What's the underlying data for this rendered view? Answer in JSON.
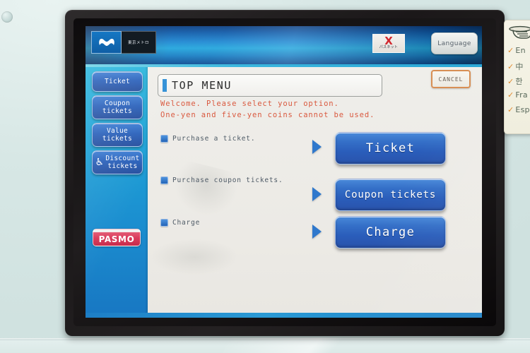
{
  "machine": {
    "brand": "Tokyo Metro",
    "metro_logo_text": "東京メトロ",
    "pasnet": {
      "mark": "X",
      "label": "パスネット"
    },
    "pasmo_label": "PASMO"
  },
  "header": {
    "language_button": "Language"
  },
  "sidebar": {
    "items": [
      {
        "label": "Ticket",
        "icon": null
      },
      {
        "label": "Coupon\ntickets",
        "line1": "Coupon",
        "line2": "tickets",
        "icon": null
      },
      {
        "label": "Value\ntickets",
        "line1": "Value",
        "line2": "tickets",
        "icon": null
      },
      {
        "label": "Discount\ntickets",
        "line1": "Discount",
        "line2": "tickets",
        "icon": "wheelchair-icon",
        "icon_glyph": "♿"
      }
    ]
  },
  "main": {
    "title": "TOP MENU",
    "welcome_line1": "Welcome. Please select your option.",
    "welcome_line2": "One-yen and five-yen coins cannot be used.",
    "cancel_button": "CANCEL",
    "options": [
      {
        "description": "Purchase a ticket.",
        "button": "Ticket"
      },
      {
        "description": "Purchase coupon tickets.",
        "button": "Coupon tickets"
      },
      {
        "description": "Charge",
        "button": "Charge"
      }
    ]
  },
  "sign": {
    "icon": "pointing-hand-icon",
    "languages": [
      {
        "check": "✓",
        "label": "En"
      },
      {
        "check": "✓",
        "label": "中"
      },
      {
        "check": "✓",
        "label": "한"
      },
      {
        "check": "✓",
        "label": "Fra"
      },
      {
        "check": "✓",
        "label": "Esp"
      }
    ]
  },
  "colors": {
    "accent_blue": "#2a5dba",
    "header_blue": "#1d86d1",
    "sidebar_cyan": "#2bb6dd",
    "alert_orange": "#d9593f",
    "pasmo_red": "#d93a5a",
    "cancel_border": "#d88f55"
  }
}
